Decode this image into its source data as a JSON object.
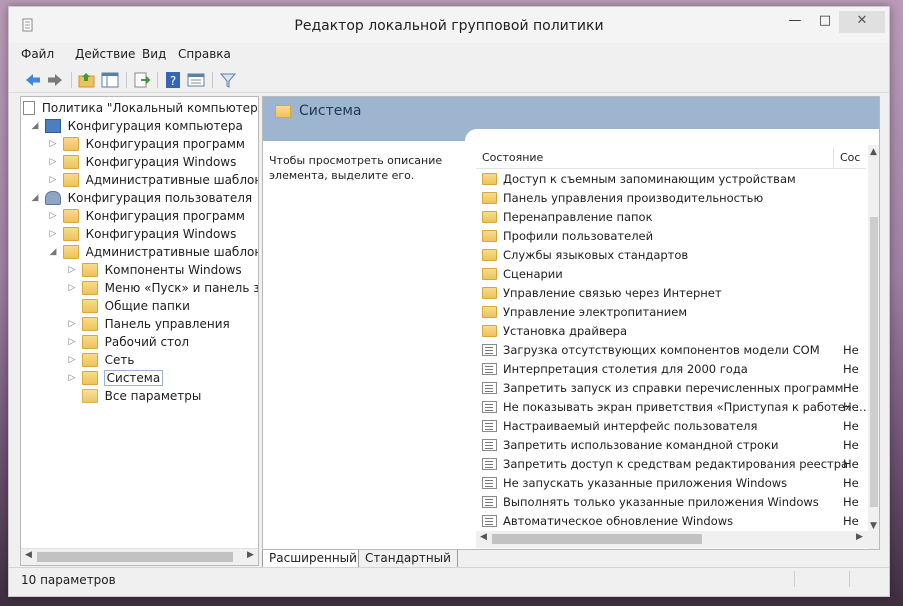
{
  "window": {
    "title": "Редактор локальной групповой политики",
    "controls": {
      "minimize": "—",
      "maximize": "□",
      "close": "✕"
    }
  },
  "menu": [
    "Файл",
    "Действие",
    "Вид",
    "Справка"
  ],
  "toolbar": {
    "icons": [
      "back-arrow-icon",
      "forward-arrow-icon",
      "up-folder-icon",
      "show-hide-tree-icon",
      "export-list-icon",
      "help-icon",
      "properties-view-icon",
      "filter-icon"
    ]
  },
  "tree": {
    "root": "Политика \"Локальный компьютер\"",
    "computer": "Конфигурация компьютера",
    "comp_programs": "Конфигурация программ",
    "comp_windows": "Конфигурация Windows",
    "comp_admin": "Административные шаблоны",
    "user": "Конфигурация пользователя",
    "user_programs": "Конфигурация программ",
    "user_windows": "Конфигурация Windows",
    "user_admin": "Административные шаблоны",
    "admin_children": [
      "Компоненты Windows",
      "Меню «Пуск» и панель зада",
      "Общие папки",
      "Панель управления",
      "Рабочий стол",
      "Сеть",
      "Система",
      "Все параметры"
    ]
  },
  "right": {
    "header_title": "Система",
    "description": "Чтобы просмотреть описание элемента, выделите его.",
    "col_state": "Состояние",
    "col_status": "Сос",
    "folders": [
      "Доступ к съемным запоминающим устройствам",
      "Панель управления производительностью",
      "Перенаправление папок",
      "Профили пользователей",
      "Службы языковых стандартов",
      "Сценарии",
      "Управление связью через Интернет",
      "Управление электропитанием",
      "Установка драйвера"
    ],
    "settings": [
      {
        "name": "Загрузка отсутствующих компонентов модели COM",
        "status": "Не"
      },
      {
        "name": "Интерпретация столетия для 2000 года",
        "status": "Не"
      },
      {
        "name": "Запретить запуск из справки перечисленных программ",
        "status": "Не"
      },
      {
        "name": "Не показывать экран приветствия «Приступая к работе» ...",
        "status": "Не"
      },
      {
        "name": "Настраиваемый интерфейс пользователя",
        "status": "Не"
      },
      {
        "name": "Запретить использование командной строки",
        "status": "Не"
      },
      {
        "name": "Запретить доступ к средствам редактирования реестра",
        "status": "Не"
      },
      {
        "name": "Не запускать указанные приложения Windows",
        "status": "Не"
      },
      {
        "name": "Выполнять только указанные приложения Windows",
        "status": "Не"
      },
      {
        "name": "Автоматическое обновление Windows",
        "status": "Не"
      }
    ]
  },
  "tabs": {
    "extended": "Расширенный",
    "standard": "Стандартный"
  },
  "status": "10 параметров",
  "colors": {
    "header_blue": "#9db5ce",
    "folder_yellow": "#eec35a",
    "accent": "#3a7bd5"
  }
}
